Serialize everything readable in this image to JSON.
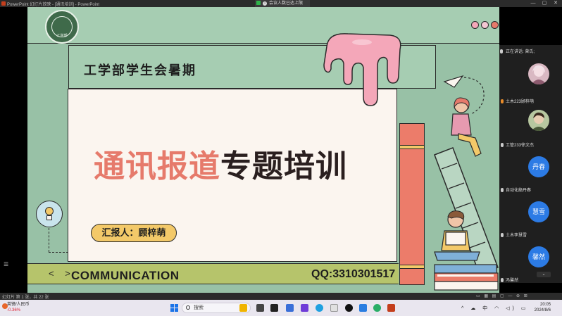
{
  "window": {
    "title": "PowerPoint 幻灯片放映 - [通讯培训] - PowerPoint",
    "minimize": "—",
    "maximize": "▢",
    "close": "✕"
  },
  "meeting_notice": "会议人数已达上限",
  "slide": {
    "logo_text": "工学部",
    "header_title": "工学部学生会暑期",
    "main_title_red": "通讯报道",
    "main_title_dark": "专题培训",
    "reporter": "汇报人：顾梓萌",
    "nav_arrows": "< >",
    "communication": "COMMUNICATION",
    "qq": "QQ:3310301517",
    "dot_colors": [
      "#f4a7b9",
      "#f4c7d3",
      "#e67a6b",
      "#6ea7d8"
    ]
  },
  "meeting": {
    "speaking_label": "正在讲话: 曾氏;",
    "participants": [
      {
        "name": "土木223顾梓萌",
        "avatar": "photo"
      },
      {
        "name": "工管233徐文杰",
        "avatar": "photo"
      },
      {
        "name": "自动化絡丹春",
        "avatar_text": "丹春"
      },
      {
        "name": "土木李慧雪",
        "avatar_text": "慧雪"
      },
      {
        "name": "冯馨然",
        "avatar_text": "馨然"
      }
    ],
    "scroll_down": "⌄"
  },
  "statusbar": {
    "slide_info": "幻灯片 第 1 张，共 22 张"
  },
  "taskbar": {
    "weather_line1": "英镑/人民币",
    "weather_line2": "-0.36%",
    "search_placeholder": "搜索",
    "tray_text": "^ ☁ 中 ◠ ◁) ▭",
    "time": "20:05",
    "date": "2024/8/6"
  }
}
